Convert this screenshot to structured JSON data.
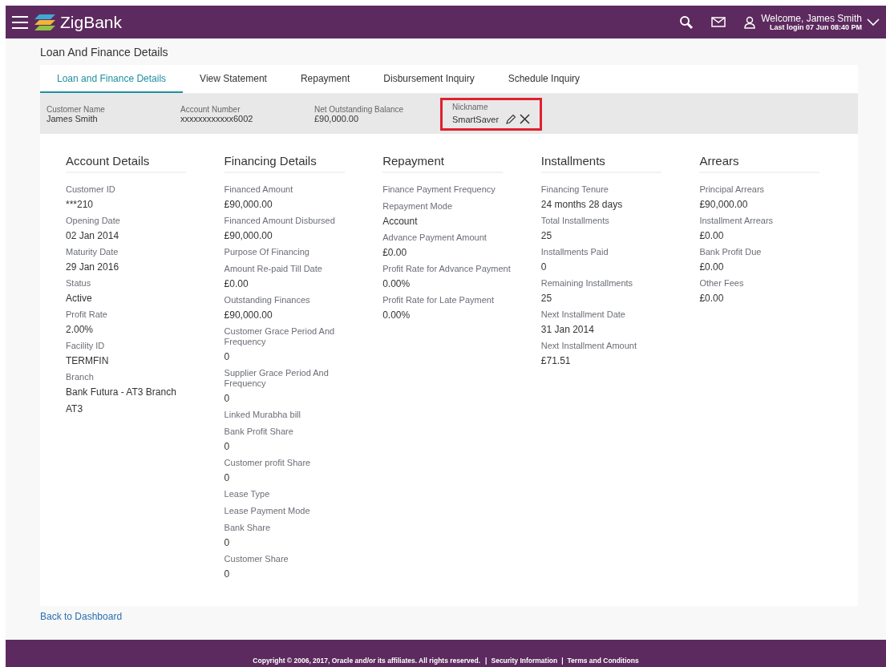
{
  "header": {
    "brand": "ZigBank",
    "welcome": "Welcome, James Smith",
    "last_login": "Last login 07 Jun 08:40 PM"
  },
  "page_title": "Loan And Finance Details",
  "tabs": [
    {
      "label": "Loan and Finance Details",
      "selected": true
    },
    {
      "label": "View Statement",
      "selected": false
    },
    {
      "label": "Repayment",
      "selected": false
    },
    {
      "label": "Disbursement Inquiry",
      "selected": false
    },
    {
      "label": "Schedule Inquiry",
      "selected": false
    }
  ],
  "summary": [
    {
      "label": "Customer Name",
      "value": "James Smith"
    },
    {
      "label": "Account Number",
      "value": "xxxxxxxxxxxx6002"
    },
    {
      "label": "Net Outstanding Balance",
      "value": "£90,000.00"
    }
  ],
  "nickname": {
    "label": "Nickname",
    "value": "SmartSaver",
    "highlighted": true
  },
  "sections": [
    {
      "title": "Account Details",
      "fields": [
        {
          "label": "Customer ID",
          "value": "***210"
        },
        {
          "label": "Opening Date",
          "value": "02 Jan 2014"
        },
        {
          "label": "Maturity Date",
          "value": "29 Jan 2016"
        },
        {
          "label": "Status",
          "value": "Active"
        },
        {
          "label": "Profit Rate",
          "value": "2.00%"
        },
        {
          "label": "Facility ID",
          "value": "TERMFIN"
        },
        {
          "label": "Branch",
          "value": "Bank Futura - AT3 Branch"
        },
        {
          "value": "AT3"
        }
      ]
    },
    {
      "title": "Financing Details",
      "fields": [
        {
          "label": "Financed Amount",
          "value": "£90,000.00"
        },
        {
          "label": "Financed Amount Disbursed",
          "value": "£90,000.00"
        },
        {
          "label": "Purpose Of Financing"
        },
        {
          "label": "Amount Re-paid Till Date",
          "value": "£0.00"
        },
        {
          "label": "Outstanding Finances",
          "value": "£90,000.00"
        },
        {
          "label": "Customer Grace Period And Frequency",
          "value": "0"
        },
        {
          "label": "Supplier Grace Period And Frequency",
          "value": "0"
        },
        {
          "label": "Linked Murabha bill"
        },
        {
          "label": "Bank Profit Share",
          "value": "0"
        },
        {
          "label": "Customer profit Share",
          "value": "0"
        },
        {
          "label": "Lease Type"
        },
        {
          "label": "Lease Payment Mode"
        },
        {
          "label": "Bank Share",
          "value": "0"
        },
        {
          "label": "Customer Share",
          "value": "0"
        }
      ]
    },
    {
      "title": "Repayment",
      "fields": [
        {
          "label": "Finance Payment Frequency"
        },
        {
          "label": "Repayment Mode",
          "value": "Account"
        },
        {
          "label": "Advance Payment Amount",
          "value": "£0.00"
        },
        {
          "label": "Profit Rate for Advance Payment",
          "value": "0.00%"
        },
        {
          "label": "Profit Rate for Late Payment",
          "value": "0.00%"
        }
      ]
    },
    {
      "title": "Installments",
      "fields": [
        {
          "label": "Financing Tenure",
          "value": "24 months 28 days"
        },
        {
          "label": "Total Installments",
          "value": "25"
        },
        {
          "label": "Installments Paid",
          "value": "0"
        },
        {
          "label": "Remaining Installments",
          "value": "25"
        },
        {
          "label": "Next Installment Date",
          "value": "31 Jan 2014"
        },
        {
          "label": "Next Installment Amount",
          "value": "£71.51"
        }
      ]
    },
    {
      "title": "Arrears",
      "fields": [
        {
          "label": "Principal Arrears",
          "value": "£90,000.00"
        },
        {
          "label": "Installment Arrears",
          "value": "£0.00"
        },
        {
          "label": "Bank Profit Due",
          "value": "£0.00"
        },
        {
          "label": "Other Fees",
          "value": "£0.00"
        }
      ]
    }
  ],
  "back_link": "Back to Dashboard",
  "footer": [
    {
      "kind": "text",
      "text": "Copyright © 2006, 2017, Oracle and/or its affiliates. All rights reserved."
    },
    {
      "kind": "sep",
      "text": "|"
    },
    {
      "kind": "link",
      "text": "Security Information"
    },
    {
      "kind": "sep",
      "text": "|"
    },
    {
      "kind": "link",
      "text": "Terms and Conditions"
    }
  ]
}
